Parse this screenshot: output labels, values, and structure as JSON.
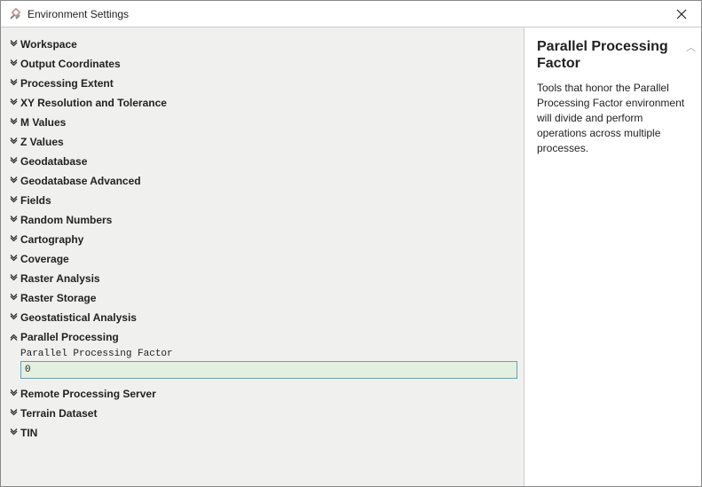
{
  "window": {
    "title": "Environment Settings"
  },
  "sections": {
    "workspace": "Workspace",
    "output_coordinates": "Output Coordinates",
    "processing_extent": "Processing Extent",
    "xy_resolution": "XY Resolution and Tolerance",
    "m_values": "M Values",
    "z_values": "Z Values",
    "geodatabase": "Geodatabase",
    "geodatabase_advanced": "Geodatabase Advanced",
    "fields": "Fields",
    "random_numbers": "Random Numbers",
    "cartography": "Cartography",
    "coverage": "Coverage",
    "raster_analysis": "Raster Analysis",
    "raster_storage": "Raster Storage",
    "geostatistical": "Geostatistical Analysis",
    "parallel_processing": "Parallel Processing",
    "remote_processing_server": "Remote Processing Server",
    "terrain_dataset": "Terrain Dataset",
    "tin": "TIN"
  },
  "parallel": {
    "field_label": "Parallel Processing Factor",
    "field_value": "0"
  },
  "help": {
    "title": "Parallel Processing Factor",
    "text": "Tools that honor the Parallel Processing Factor environment will divide and perform operations across multiple processes."
  }
}
